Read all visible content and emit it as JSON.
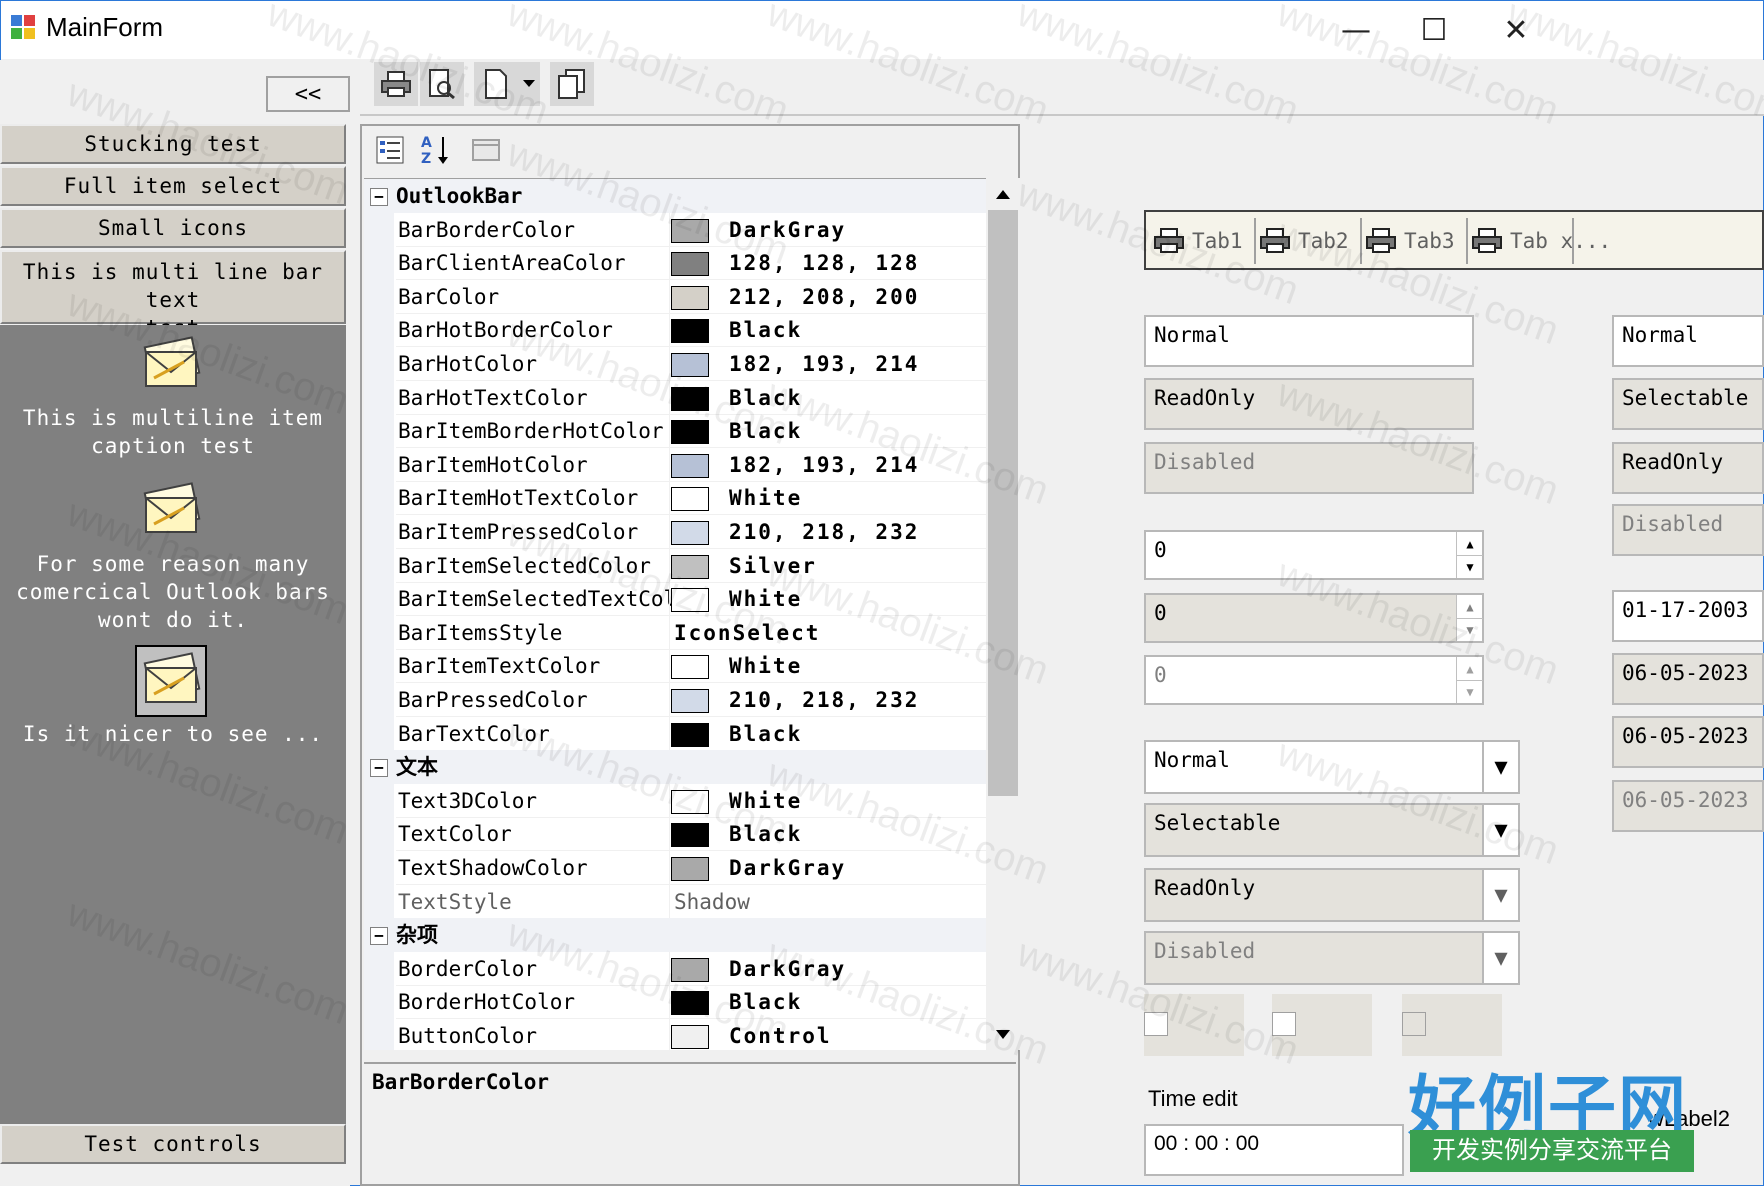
{
  "window": {
    "title": "MainForm",
    "minimize": "—",
    "maximize": "☐",
    "close": "✕"
  },
  "outlook": {
    "collapse_label": "<<",
    "bars": [
      {
        "label": "Stucking test"
      },
      {
        "label": "Full item select"
      },
      {
        "label": "Small icons"
      },
      {
        "label_line1": "This is multi line bar text",
        "label_line2": "test"
      }
    ],
    "items": [
      {
        "icon": "envelope-icon",
        "line1": "This is multiline item",
        "line2": "caption test"
      },
      {
        "icon": "envelope-icon",
        "line1": "For some reason many",
        "line2": "comercical Outlook bars",
        "line3": "wont do it."
      },
      {
        "icon": "envelope-icon",
        "line1": "Is it nicer to see ..."
      }
    ],
    "bottom_bar": "Test controls"
  },
  "toolbar": {
    "buttons": [
      "print-icon",
      "print-preview-icon",
      "new-document-icon",
      "dropdown-arrow-icon",
      "copy-icon"
    ]
  },
  "propgrid": {
    "toolbar": [
      "categorized-icon",
      "alphabetical-icon",
      "property-pages-icon"
    ],
    "categories": [
      {
        "name": "OutlookBar",
        "toggle": "⊟"
      },
      {
        "name": "文本",
        "toggle": "⊟"
      },
      {
        "name": "杂项",
        "toggle": "⊟"
      }
    ],
    "rows": [
      {
        "name": "BarBorderColor",
        "value": "DarkGray",
        "color": "#a9a9a9"
      },
      {
        "name": "BarClientAreaColor",
        "value": "128, 128, 128",
        "color": "#808080"
      },
      {
        "name": "BarColor",
        "value": "212, 208, 200",
        "color": "#d4d0c8"
      },
      {
        "name": "BarHotBorderColor",
        "value": "Black",
        "color": "#000000"
      },
      {
        "name": "BarHotColor",
        "value": "182, 193, 214",
        "color": "#b6c1d6"
      },
      {
        "name": "BarHotTextColor",
        "value": "Black",
        "color": "#000000"
      },
      {
        "name": "BarItemBorderHotColor",
        "value": "Black",
        "color": "#000000"
      },
      {
        "name": "BarItemHotColor",
        "value": "182, 193, 214",
        "color": "#b6c1d6"
      },
      {
        "name": "BarItemHotTextColor",
        "value": "White",
        "color": "#ffffff"
      },
      {
        "name": "BarItemPressedColor",
        "value": "210, 218, 232",
        "color": "#d2dae8"
      },
      {
        "name": "BarItemSelectedColor",
        "value": "Silver",
        "color": "#c0c0c0"
      },
      {
        "name": "BarItemSelectedTextColc",
        "value": "White",
        "color": "#ffffff"
      },
      {
        "name": "BarItemsStyle",
        "value": "IconSelect"
      },
      {
        "name": "BarItemTextColor",
        "value": "White",
        "color": "#ffffff"
      },
      {
        "name": "BarPressedColor",
        "value": "210, 218, 232",
        "color": "#d2dae8"
      },
      {
        "name": "BarTextColor",
        "value": "Black",
        "color": "#000000"
      },
      {
        "name": "Text3DColor",
        "value": "White",
        "color": "#ffffff"
      },
      {
        "name": "TextColor",
        "value": "Black",
        "color": "#000000"
      },
      {
        "name": "TextShadowColor",
        "value": "DarkGray",
        "color": "#a9a9a9"
      },
      {
        "name": "TextStyle",
        "value": "Shadow"
      },
      {
        "name": "BorderColor",
        "value": "DarkGray",
        "color": "#a9a9a9"
      },
      {
        "name": "BorderHotColor",
        "value": "Black",
        "color": "#000000"
      },
      {
        "name": "ButtonColor",
        "value": "Control",
        "color": "#f0f0f0"
      }
    ],
    "help_title": "BarBorderColor"
  },
  "tabs": [
    {
      "label": "Tab1",
      "icon": "printer-icon"
    },
    {
      "label": "Tab2",
      "icon": "printer-icon"
    },
    {
      "label": "Tab3",
      "icon": "printer-icon"
    },
    {
      "label": "Tab x...",
      "icon": "printer-icon"
    }
  ],
  "textboxes": {
    "normal": "Normal",
    "readonly": "ReadOnly",
    "disabled": "Disabled"
  },
  "spinners": [
    "0",
    "0",
    "0"
  ],
  "combos": [
    "Normal",
    "Selectable",
    "ReadOnly",
    "Disabled"
  ],
  "right_col": {
    "boxes": [
      "Normal",
      "Selectable",
      "ReadOnly",
      "Disabled"
    ],
    "dates": [
      "01-17-2003",
      "06-05-2023",
      "06-05-2023",
      "06-05-2023"
    ]
  },
  "time": {
    "label": "Time edit",
    "value": "00 : 00 : 00"
  },
  "wlabel": "wLabel2",
  "watermark": {
    "text": "www.haolizi.com",
    "brand_cn": "好例子网",
    "brand_sub": "开发实例分享交流平台"
  }
}
